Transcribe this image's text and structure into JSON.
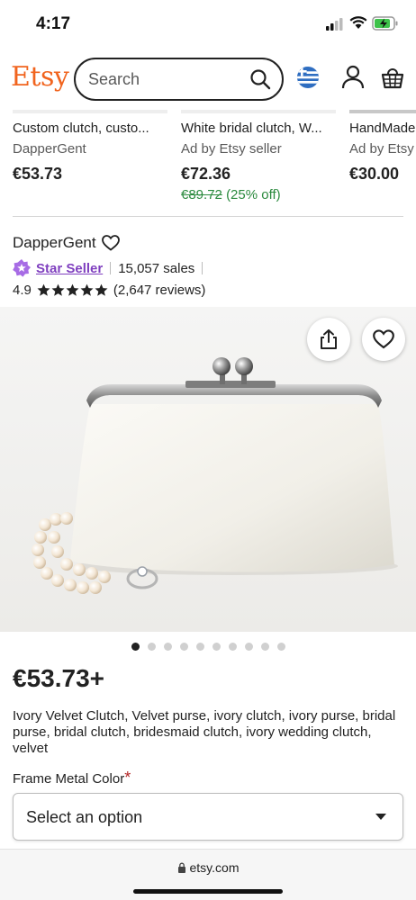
{
  "status_bar": {
    "time": "4:17"
  },
  "header": {
    "logo": "Etsy",
    "search_placeholder": "Search"
  },
  "carousel": {
    "cards": [
      {
        "title": "Custom clutch, custo...",
        "seller": "DapperGent",
        "price": "€53.73"
      },
      {
        "title": "White bridal clutch, W...",
        "seller": "Ad by Etsy seller",
        "price": "€72.36",
        "original_price": "€89.72",
        "discount": "(25% off)"
      },
      {
        "title": "HandMade",
        "seller": "Ad by Etsy",
        "price": "€30.00"
      }
    ]
  },
  "shop": {
    "name": "DapperGent",
    "badge": "Star Seller",
    "sales": "15,057 sales",
    "rating": "4.9",
    "stars": 5,
    "reviews": "(2,647 reviews)"
  },
  "listing": {
    "image_count": 10,
    "active_image": 1,
    "price": "€53.73+",
    "title": "Ivory Velvet Clutch, Velvet purse, ivory clutch, ivory purse, bridal purse, bridal clutch, bridesmaid clutch, ivory wedding clutch, velvet",
    "option_label": "Frame Metal Color",
    "option_required_mark": "*",
    "select_value": "Select an option"
  },
  "browser": {
    "url": "etsy.com"
  },
  "colors": {
    "brand": "#f1641e",
    "star_seller": "#7f3fbf",
    "discount": "#2b8a3e",
    "required": "#b32424"
  }
}
